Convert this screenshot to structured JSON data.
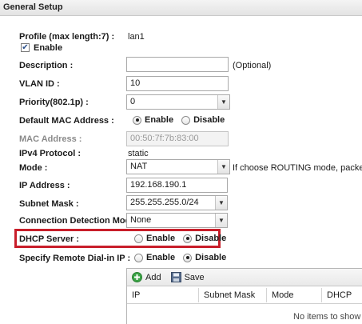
{
  "panel": {
    "title": "General Setup"
  },
  "profile": {
    "label": "Profile (max length:7) :",
    "value": "lan1"
  },
  "enable": {
    "label": "Enable",
    "checked": true
  },
  "description": {
    "label": "Description :",
    "value": "",
    "hint": "(Optional)"
  },
  "vlan": {
    "label": "VLAN ID :",
    "value": "10"
  },
  "priority": {
    "label": "Priority(802.1p) :",
    "value": "0"
  },
  "default_mac": {
    "label": "Default MAC Address :",
    "opt_enable": "Enable",
    "opt_disable": "Disable",
    "selected": "Enable"
  },
  "mac": {
    "label": "MAC Address :",
    "value": "00:50:7f:7b:83:00"
  },
  "ipv4": {
    "label": "IPv4 Protocol :",
    "value": "static"
  },
  "mode": {
    "label": "Mode :",
    "value": "NAT",
    "hint": "If choose ROUTING mode, packets w"
  },
  "ip_address": {
    "label": "IP Address :",
    "value": "192.168.190.1"
  },
  "subnet": {
    "label": "Subnet Mask :",
    "value": "255.255.255.0/24"
  },
  "conn_detect": {
    "label": "Connection Detection Mode :",
    "value": "None"
  },
  "dhcp_server": {
    "label": "DHCP Server :",
    "opt_enable": "Enable",
    "opt_disable": "Disable",
    "selected": "Disable"
  },
  "remote_dial": {
    "label": "Specify Remote Dial-in IP :",
    "opt_enable": "Enable",
    "opt_disable": "Disable",
    "selected": "Disable"
  },
  "grid": {
    "add_label": "Add",
    "save_label": "Save",
    "columns": [
      "IP",
      "Subnet Mask",
      "Mode",
      "DHCP"
    ],
    "empty_text": "No items to show"
  },
  "colors": {
    "highlight": "#c81e2a"
  }
}
